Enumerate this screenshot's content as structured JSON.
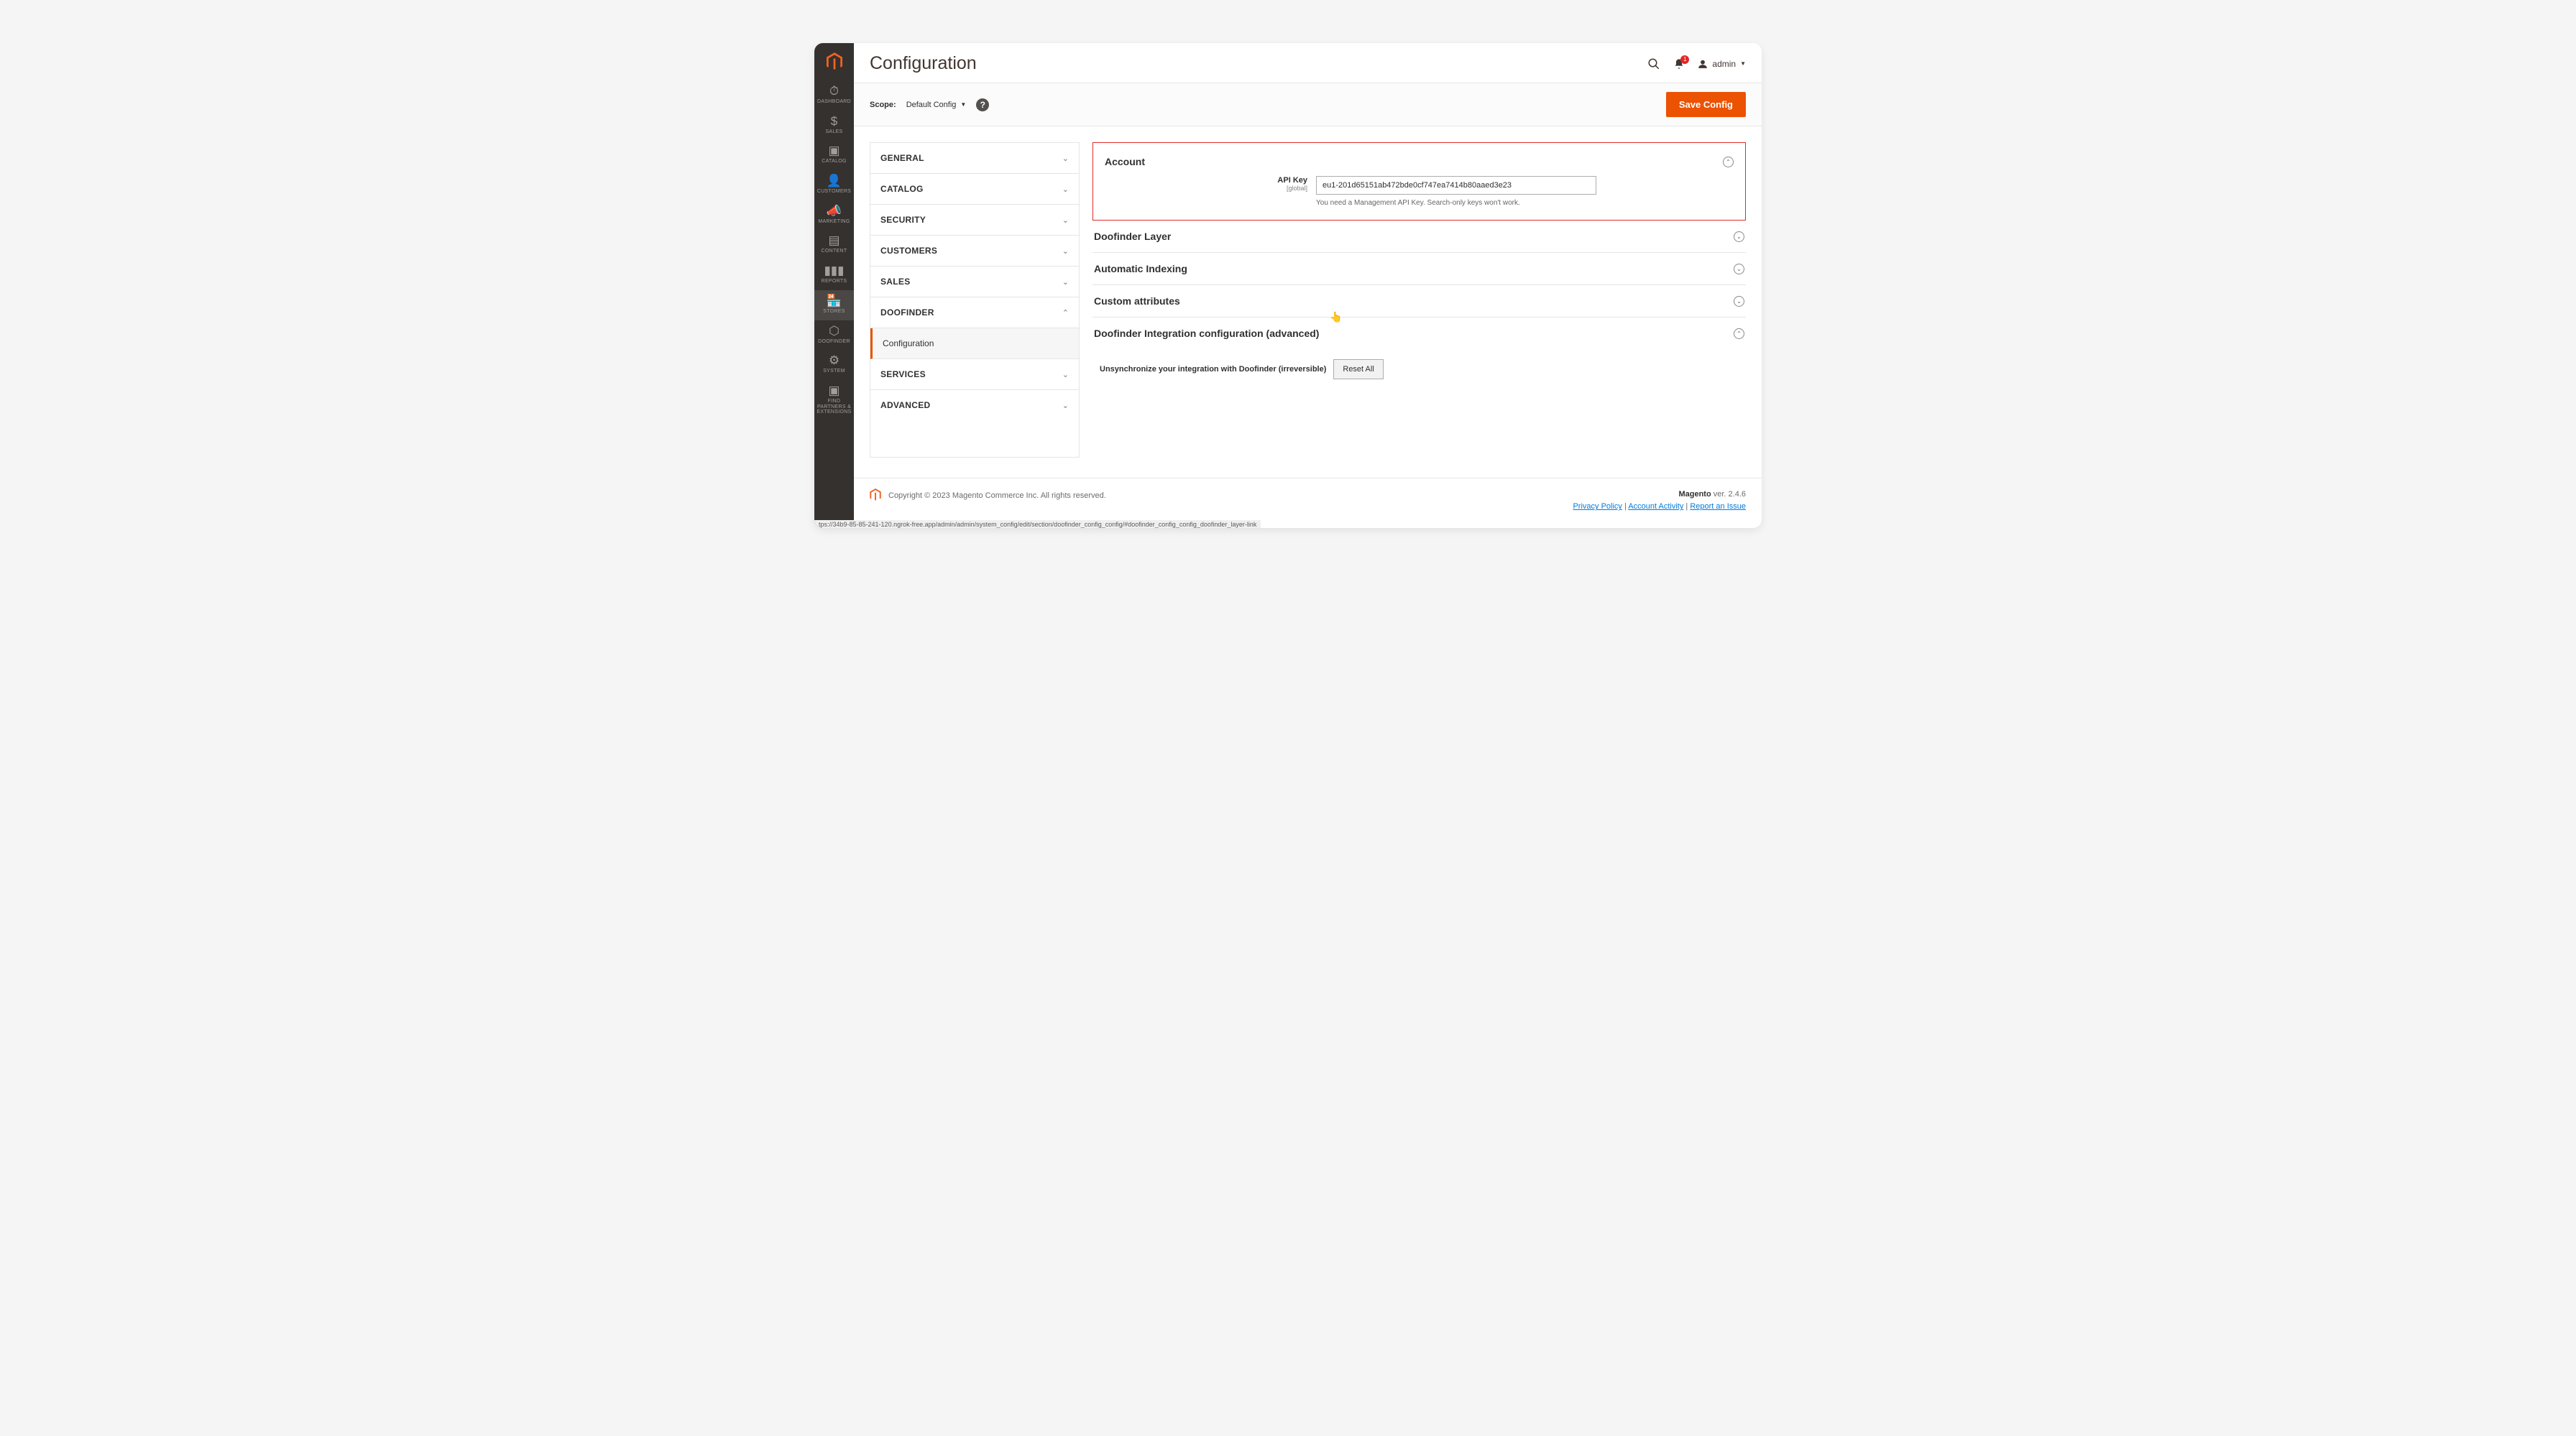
{
  "page_title": "Configuration",
  "notification_count": "1",
  "admin_user": "admin",
  "scope": {
    "label": "Scope:",
    "value": "Default Config"
  },
  "save_button": "Save Config",
  "sidebar": {
    "items": [
      {
        "label": "DASHBOARD",
        "glyph": "⏱"
      },
      {
        "label": "SALES",
        "glyph": "$"
      },
      {
        "label": "CATALOG",
        "glyph": "▣"
      },
      {
        "label": "CUSTOMERS",
        "glyph": "👤"
      },
      {
        "label": "MARKETING",
        "glyph": "📣"
      },
      {
        "label": "CONTENT",
        "glyph": "▤"
      },
      {
        "label": "REPORTS",
        "glyph": "▮▮▮"
      },
      {
        "label": "STORES",
        "glyph": "🏪"
      },
      {
        "label": "DOOFINDER",
        "glyph": "⬡"
      },
      {
        "label": "SYSTEM",
        "glyph": "⚙"
      },
      {
        "label": "FIND PARTNERS & EXTENSIONS",
        "glyph": "▣"
      }
    ],
    "active_index": 7
  },
  "tree": {
    "sections": [
      {
        "label": "GENERAL",
        "expanded": false
      },
      {
        "label": "CATALOG",
        "expanded": false
      },
      {
        "label": "SECURITY",
        "expanded": false
      },
      {
        "label": "CUSTOMERS",
        "expanded": false
      },
      {
        "label": "SALES",
        "expanded": false
      },
      {
        "label": "DOOFINDER",
        "expanded": true,
        "children": [
          {
            "label": "Configuration"
          }
        ]
      },
      {
        "label": "SERVICES",
        "expanded": false
      },
      {
        "label": "ADVANCED",
        "expanded": false
      }
    ]
  },
  "panels": {
    "account": {
      "title": "Account",
      "field_label": "API Key",
      "field_scope": "[global]",
      "field_value": "eu1-201d65151ab472bde0cf747ea7414b80aaed3e23",
      "field_help": "You need a Management API Key. Search-only keys won't work."
    },
    "layer": {
      "title": "Doofinder Layer"
    },
    "index": {
      "title": "Automatic Indexing"
    },
    "custom": {
      "title": "Custom attributes"
    },
    "advanced": {
      "title": "Doofinder Integration configuration (advanced)",
      "text": "Unsynchronize your integration with Doofinder (irreversible)",
      "button": "Reset All"
    }
  },
  "footer": {
    "copyright": "Copyright © 2023 Magento Commerce Inc. All rights reserved.",
    "version_prefix": "Magento",
    "version": " ver. 2.4.6",
    "links": {
      "privacy": "Privacy Policy",
      "activity": "Account Activity",
      "report": "Report an Issue"
    }
  },
  "status_url": "tps://34b9-85-85-241-120.ngrok-free.app/admin/admin/system_config/edit/section/doofinder_config_config/#doofinder_config_config_doofinder_layer-link"
}
